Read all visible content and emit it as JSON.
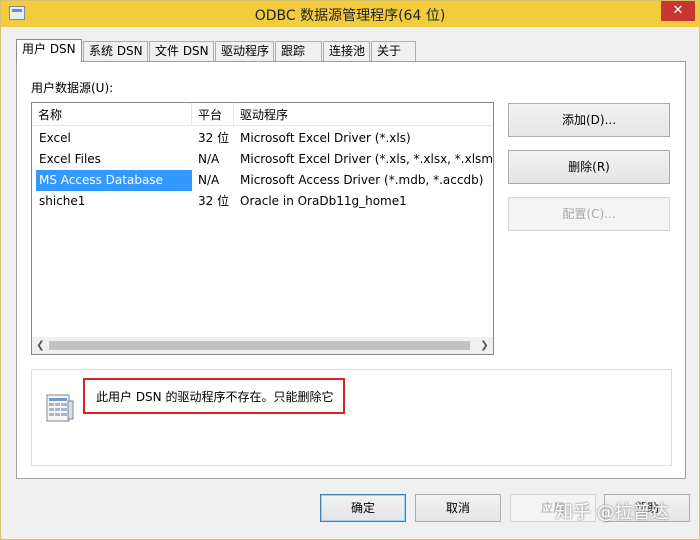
{
  "window": {
    "title": "ODBC 数据源管理程序(64 位)",
    "close_label": "✕"
  },
  "tabs": [
    {
      "label": "用户 DSN"
    },
    {
      "label": "系统 DSN"
    },
    {
      "label": "文件 DSN"
    },
    {
      "label": "驱动程序"
    },
    {
      "label": "跟踪"
    },
    {
      "label": "连接池"
    },
    {
      "label": "关于"
    }
  ],
  "panel": {
    "user_sources_label": "用户数据源(U):",
    "columns": [
      "名称",
      "平台",
      "驱动程序"
    ],
    "rows": [
      {
        "name": "Excel",
        "platform": "32 位",
        "driver": "Microsoft Excel Driver (*.xls)"
      },
      {
        "name": "Excel Files",
        "platform": "N/A",
        "driver": "Microsoft Excel Driver (*.xls, *.xlsx, *.xlsm, *.xlsb)"
      },
      {
        "name": "MS Access Database",
        "platform": "N/A",
        "driver": "Microsoft Access Driver (*.mdb, *.accdb)"
      },
      {
        "name": "shiche1",
        "platform": "32 位",
        "driver": "Oracle in OraDb11g_home1"
      }
    ],
    "selected_row": "MS Access Database",
    "buttons": {
      "add": "添加(D)...",
      "remove": "删除(R)",
      "configure": "配置(C)..."
    },
    "message": "此用户 DSN 的驱动程序不存在。只能删除它"
  },
  "footer": {
    "ok": "确定",
    "cancel": "取消",
    "apply": "应用",
    "help": "帮助"
  },
  "watermark": "知乎 @拉普达",
  "colors": {
    "titlebar": "#f2cc3c",
    "selection": "#3399ff",
    "highlight_border": "#e02020"
  }
}
